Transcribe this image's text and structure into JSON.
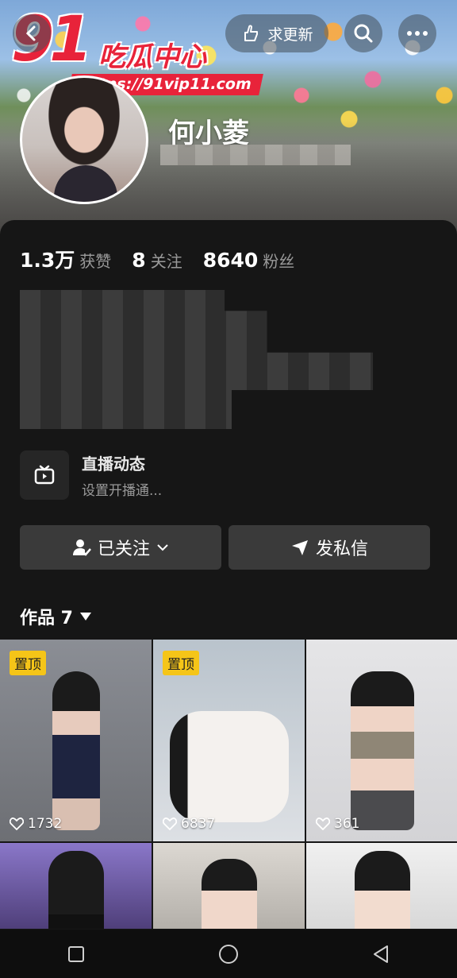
{
  "header": {
    "request_update_label": "求更新",
    "watermark": {
      "brand_number": "91",
      "brand_text": "吃瓜中心",
      "url": "https://91vip11.com"
    }
  },
  "profile": {
    "name": "何小菱",
    "stats": [
      {
        "value": "1.3万",
        "label": "获赞"
      },
      {
        "value": "8",
        "label": "关注"
      },
      {
        "value": "8640",
        "label": "粉丝"
      }
    ]
  },
  "live": {
    "title": "直播动态",
    "subtitle": "设置开播通..."
  },
  "actions": {
    "follow_label": "已关注",
    "dm_label": "发私信"
  },
  "works": {
    "tab_label": "作品 7",
    "items": [
      {
        "pinned": true,
        "pin_label": "置顶",
        "likes": "1732"
      },
      {
        "pinned": true,
        "pin_label": "置顶",
        "likes": "6837"
      },
      {
        "pinned": false,
        "likes": "361"
      },
      {
        "pinned": false
      },
      {
        "pinned": false
      },
      {
        "pinned": false
      }
    ]
  },
  "colors": {
    "accent_red": "#e8233a",
    "pin_yellow": "#f5c518",
    "panel_bg": "#161616",
    "button_bg": "#3a3a3a"
  }
}
